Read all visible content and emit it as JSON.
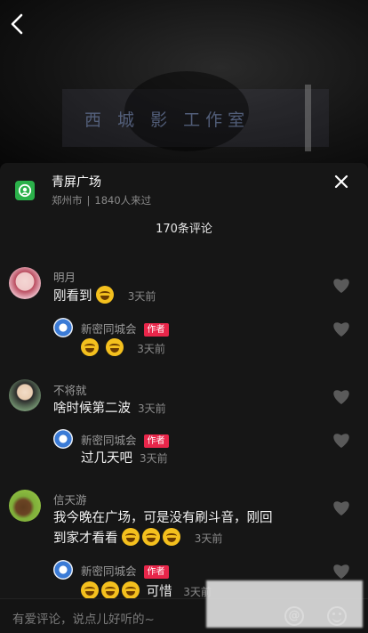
{
  "video": {
    "sign_text": "西 城 影 工作室"
  },
  "place": {
    "name": "青屏广场",
    "city": "郑州市",
    "separator": "|",
    "visitors": "1840人来过"
  },
  "comments_count": "170条评论",
  "author_badge": "作者",
  "comments": [
    {
      "user": "明月",
      "text": "刚看到",
      "emoji_count": 1,
      "time": "3天前",
      "reply": {
        "user": "新密同城会",
        "text": "",
        "emoji_count": 2,
        "time": "3天前"
      }
    },
    {
      "user": "不将就",
      "text": "啥时候第二波",
      "emoji_count": 0,
      "time": "3天前",
      "reply": {
        "user": "新密同城会",
        "text": "过几天吧",
        "emoji_count": 0,
        "time": "3天前"
      }
    },
    {
      "user": "信天游",
      "text_line1": "我今晚在广场，可是没有刷斗音，刚回",
      "text_line2": "到家才看看",
      "emoji_count": 3,
      "time": "3天前",
      "reply": {
        "user": "新密同城会",
        "text": "可惜",
        "emoji_count": 3,
        "time": "3天前"
      }
    }
  ],
  "input": {
    "placeholder": "有爱评论，说点儿好听的~"
  },
  "icons": {
    "back": "chevron-left-icon",
    "close": "close-icon",
    "place": "location-pin-icon",
    "like": "heart-icon",
    "at": "at-icon",
    "emoji": "smile-icon"
  },
  "colors": {
    "badge": "#e8264a",
    "place_icon": "#2bb14a"
  }
}
